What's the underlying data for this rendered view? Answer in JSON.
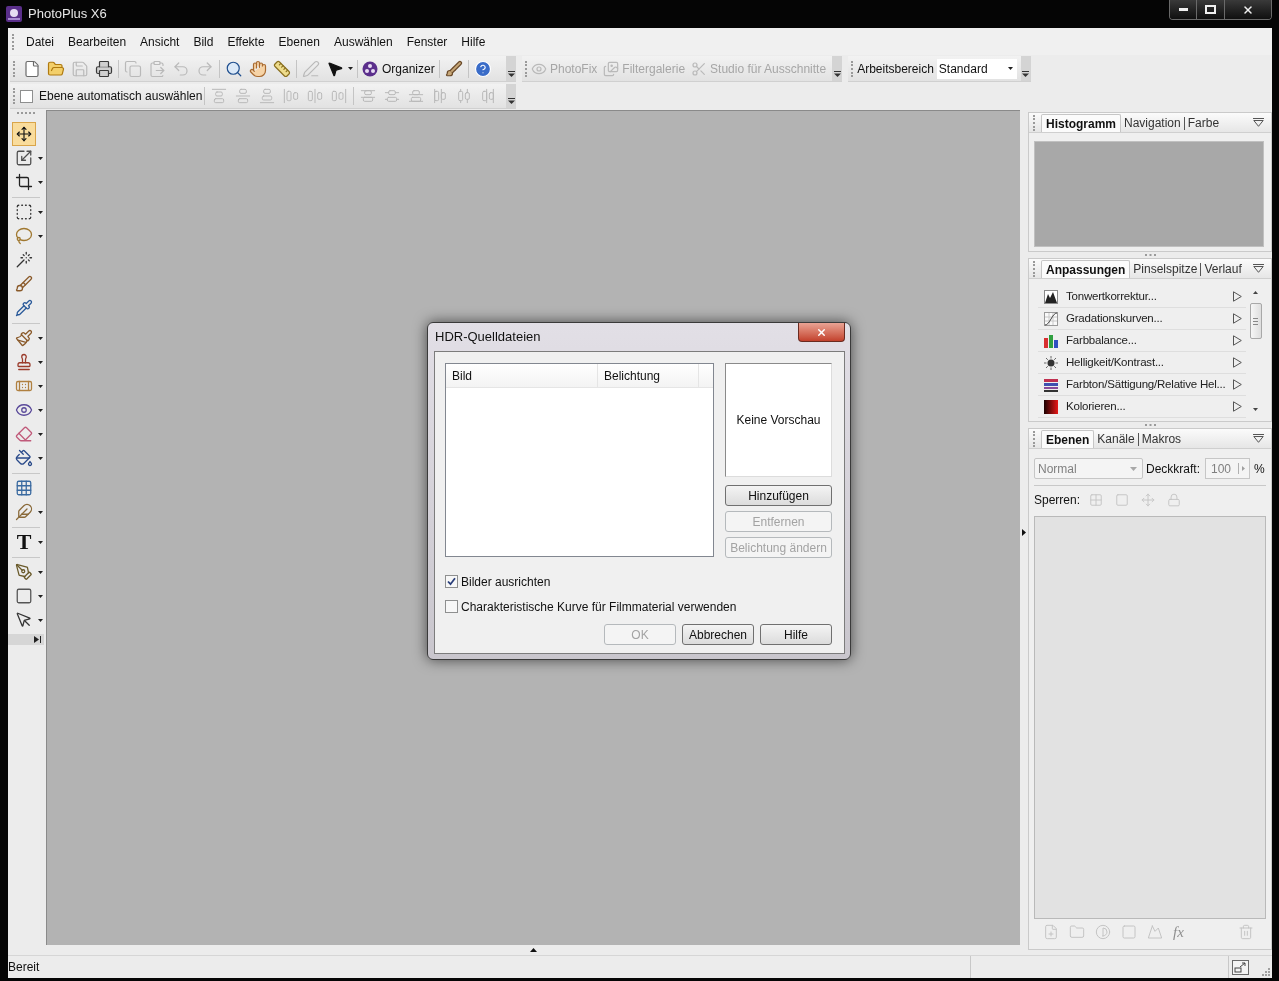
{
  "window": {
    "title": "PhotoPlus X6"
  },
  "menu": [
    "Datei",
    "Bearbeiten",
    "Ansicht",
    "Bild",
    "Effekte",
    "Ebenen",
    "Auswählen",
    "Fenster",
    "Hilfe"
  ],
  "standard_toolbar": {
    "groups": [
      [
        {
          "disabled": false
        },
        {
          "disabled": false
        },
        {
          "disabled": true
        },
        {
          "disabled": false
        }
      ],
      [
        {
          "disabled": true
        },
        {
          "disabled": true
        },
        {
          "disabled": true
        },
        {
          "disabled": true
        }
      ],
      [
        {
          "disabled": false
        },
        {
          "disabled": false
        },
        {
          "disabled": false
        }
      ],
      [
        {
          "disabled": true
        },
        {
          "disabled": false
        }
      ],
      [
        {
          "label": "Organizer",
          "disabled": false
        }
      ],
      [
        {
          "disabled": false
        }
      ],
      [
        {
          "disabled": false
        }
      ]
    ]
  },
  "effects_toolbar": {
    "items": [
      {
        "label": "PhotoFix",
        "disabled": true
      },
      {
        "label": "Filtergalerie",
        "disabled": true
      },
      {
        "label": "Studio für Ausschnitte",
        "disabled": true
      }
    ]
  },
  "workspace_toolbar": {
    "label": "Arbeitsbereich",
    "value": "Standard"
  },
  "context_toolbar": {
    "auto_select": {
      "label": "Ebene automatisch auswählen",
      "checked": false
    },
    "align_groups": [
      [
        {
          "disabled": true
        },
        {
          "disabled": true
        },
        {
          "disabled": true
        },
        {
          "disabled": true
        },
        {
          "disabled": true
        },
        {
          "disabled": true
        }
      ],
      [
        {
          "disabled": true
        },
        {
          "disabled": true
        },
        {
          "disabled": true
        },
        {
          "disabled": true
        },
        {
          "disabled": true
        },
        {
          "disabled": true
        }
      ]
    ]
  },
  "tools": {
    "groups": [
      [
        {
          "selected": true
        },
        {
          "selected": false
        },
        {
          "selected": false
        }
      ],
      [
        {
          "selected": false
        },
        {
          "selected": false
        },
        {
          "selected": false
        },
        {
          "selected": false
        },
        {
          "selected": false
        }
      ],
      [
        {
          "selected": false
        },
        {
          "selected": false
        },
        {
          "selected": false
        },
        {
          "selected": false
        },
        {
          "selected": false
        },
        {
          "selected": false
        }
      ],
      [
        {
          "selected": false
        },
        {
          "selected": false
        }
      ],
      [
        {
          "selected": false,
          "glyph": "T"
        }
      ],
      [
        {
          "selected": false
        },
        {
          "selected": false
        },
        {
          "selected": false
        }
      ]
    ]
  },
  "dialog": {
    "title": "HDR-Quelldateien",
    "file_list": {
      "columns": [
        "Bild",
        "Belichtung"
      ]
    },
    "preview": {
      "text": "Keine Vorschau"
    },
    "side_buttons": [
      {
        "label": "Hinzufügen",
        "disabled": false
      },
      {
        "label": "Entfernen",
        "disabled": true
      },
      {
        "label": "Belichtung ändern",
        "disabled": true
      }
    ],
    "options": [
      {
        "label": "Bilder ausrichten",
        "checked": true
      },
      {
        "label": "Charakteristische Kurve für Filmmaterial verwenden",
        "checked": false
      }
    ],
    "buttons": [
      {
        "label": "OK",
        "disabled": true
      },
      {
        "label": "Abbrechen",
        "disabled": false
      },
      {
        "label": "Hilfe",
        "disabled": false
      }
    ]
  },
  "histogram_panel": {
    "tabs": [
      {
        "label": "Histogramm",
        "selected": true
      },
      {
        "label": "Navigation",
        "selected": false
      },
      {
        "label": "Farbe",
        "selected": false
      }
    ]
  },
  "adjustments_panel": {
    "tabs": [
      {
        "label": "Anpassungen",
        "selected": true
      },
      {
        "label": "Pinselspitze",
        "selected": false
      },
      {
        "label": "Verlauf",
        "selected": false
      }
    ],
    "items": [
      {
        "label": "Tonwertkorrektur..."
      },
      {
        "label": "Gradationskurven..."
      },
      {
        "label": "Farbbalance..."
      },
      {
        "label": "Helligkeit/Kontrast..."
      },
      {
        "label": "Farbton/Sättigung/Relative Hel..."
      },
      {
        "label": "Kolorieren..."
      }
    ]
  },
  "layers_panel": {
    "tabs": [
      {
        "label": "Ebenen",
        "selected": true
      },
      {
        "label": "Kanäle",
        "selected": false
      },
      {
        "label": "Makros",
        "selected": false
      }
    ],
    "blend_mode": {
      "value": "Normal",
      "disabled": true
    },
    "opacity": {
      "label": "Deckkraft:",
      "value": "100",
      "unit": "%",
      "disabled": true
    },
    "locks": {
      "label": "Sperren:",
      "items": [
        {
          "disabled": true
        },
        {
          "disabled": true
        },
        {
          "disabled": true
        },
        {
          "disabled": true
        }
      ]
    },
    "footer_buttons": [
      {
        "disabled": true
      },
      {
        "disabled": true
      },
      {
        "disabled": true
      },
      {
        "disabled": true
      },
      {
        "disabled": true
      },
      {
        "glyph": "fx",
        "disabled": true
      },
      {
        "disabled": true
      }
    ]
  },
  "status_bar": {
    "text": "Bereit"
  }
}
